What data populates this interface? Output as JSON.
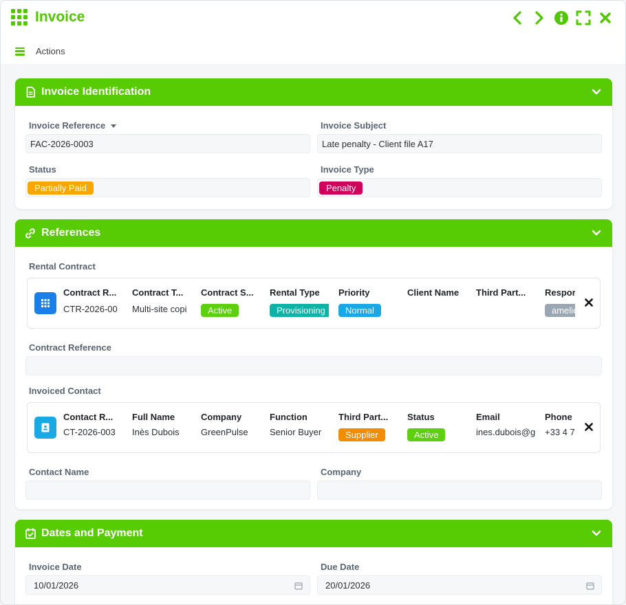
{
  "app": {
    "title": "Invoice"
  },
  "actions": {
    "label": "Actions"
  },
  "colors": {
    "accent": "#57cc05",
    "orange": "#f7a700",
    "crimson": "#d0005a",
    "green": "#5ccf0f",
    "teal": "#0fb3a6",
    "blue": "#1aa7e6",
    "gray": "#9aa7b3",
    "darkorange": "#f28c00"
  },
  "identification": {
    "title": "Invoice Identification",
    "reference_label": "Invoice Reference",
    "reference_value": "FAC-2026-0003",
    "subject_label": "Invoice Subject",
    "subject_value": "Late penalty - Client file A17",
    "status_label": "Status",
    "status_value": "Partially Paid",
    "type_label": "Invoice Type",
    "type_value": "Penalty"
  },
  "references": {
    "title": "References",
    "rental_contract_label": "Rental Contract",
    "rental": {
      "headers": [
        "Contract R...",
        "Contract T...",
        "Contract S...",
        "Rental Type",
        "Priority",
        "Client Name",
        "Third Part...",
        "Respor"
      ],
      "values": {
        "ref": "CTR-2026-00",
        "title": "Multi-site copi",
        "status": "Active",
        "rental_type": "Provisioning",
        "priority": "Normal",
        "responsible": "amelie"
      }
    },
    "contract_reference_label": "Contract Reference",
    "invoiced_contact_label": "Invoiced Contact",
    "contact": {
      "headers": [
        "Contact R...",
        "Full Name",
        "Company",
        "Function",
        "Third Part...",
        "Status",
        "Email",
        "Phone"
      ],
      "values": {
        "ref": "CT-2026-003",
        "full_name": "Inès Dubois",
        "company": "GreenPulse",
        "function": "Senior Buyer",
        "third_party": "Supplier",
        "status": "Active",
        "email": "ines.dubois@g",
        "phone": "+33 4 7"
      }
    },
    "contact_name_label": "Contact Name",
    "company_label": "Company"
  },
  "dates": {
    "title": "Dates and Payment",
    "invoice_date_label": "Invoice Date",
    "invoice_date_value": "10/01/2026",
    "due_date_label": "Due Date",
    "due_date_value": "20/01/2026"
  }
}
